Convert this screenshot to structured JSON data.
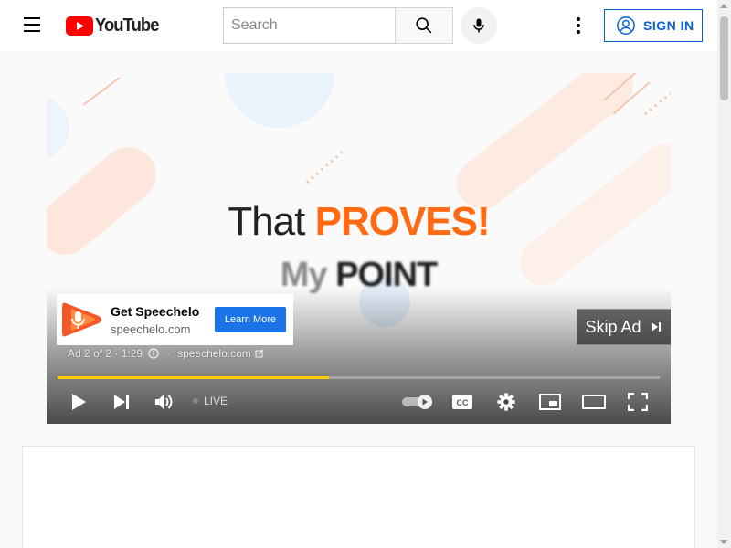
{
  "masthead": {
    "logo_text": "YouTube",
    "search_placeholder": "Search",
    "signin_label": "SIGN IN",
    "icons": [
      "menu-icon",
      "youtube-logo-icon",
      "search-icon",
      "mic-icon",
      "more-vert-icon",
      "account-icon"
    ]
  },
  "video": {
    "headline_plain": "That",
    "headline_accent": "PROVES!",
    "subline_light": "My",
    "subline_bold": "POINT",
    "accent_color": "#ff6a13"
  },
  "ad": {
    "title": "Get Speechelo",
    "domain": "speechelo.com",
    "cta_label": "Learn More",
    "counter": "Ad 2 of 2 · 1:29",
    "link_domain": "speechelo.com",
    "skip_label": "Skip Ad"
  },
  "player": {
    "progress_fraction": 0.45,
    "progress_color": "#ffcc00",
    "live_label": "LIVE",
    "controls": [
      "play-icon",
      "next-icon",
      "volume-icon",
      "autoplay-toggle",
      "cc-icon",
      "settings-icon",
      "miniplayer-icon",
      "theater-icon",
      "fullscreen-icon"
    ]
  }
}
